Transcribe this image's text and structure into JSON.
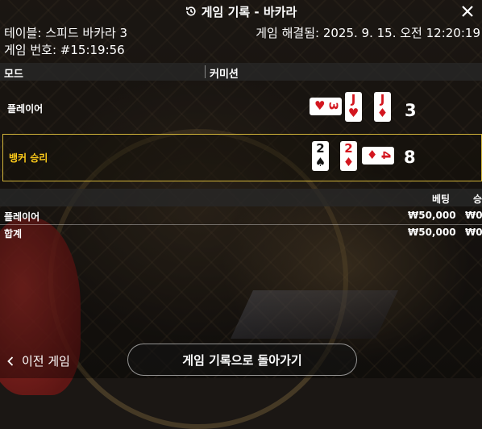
{
  "header": {
    "title": "게임 기록 - 바카라",
    "history_icon": "history-icon",
    "close_icon": "close-icon"
  },
  "info": {
    "table": "테이블: 스피드 바카라 3",
    "game_number": "게임 번호: #15:19:56",
    "resolved": "게임 해결됨: 2025. 9. 15. 오전 12:20:19"
  },
  "modebar": {
    "mode": "모드",
    "commission": "커미션"
  },
  "player": {
    "label": "플레이어",
    "score": "3",
    "cards": [
      {
        "rank": "3",
        "suit": "♥",
        "color": "red",
        "orientation": "side"
      },
      {
        "rank": "J",
        "suit": "♥",
        "color": "red",
        "orientation": "up"
      },
      {
        "rank": "J",
        "suit": "♦",
        "color": "red",
        "orientation": "up"
      }
    ]
  },
  "banker": {
    "label": "뱅커 승리",
    "score": "8",
    "cards": [
      {
        "rank": "2",
        "suit": "♠",
        "color": "black",
        "orientation": "up"
      },
      {
        "rank": "2",
        "suit": "♦",
        "color": "red",
        "orientation": "up"
      },
      {
        "rank": "4",
        "suit": "♦",
        "color": "red",
        "orientation": "side"
      }
    ]
  },
  "bets_table": {
    "headers": {
      "bet": "베팅",
      "win": "승"
    },
    "rows": [
      {
        "name": "플레이어",
        "bet": "₩50,000",
        "win": "₩0"
      },
      {
        "name": "합계",
        "bet": "₩50,000",
        "win": "₩0"
      }
    ]
  },
  "footer": {
    "back_label": "이전 게임",
    "return_label": "게임 기록으로 돌아가기"
  },
  "colors": {
    "highlight": "#d2b43a",
    "banker_text": "#ffcc1a",
    "card_red": "#d3161f"
  }
}
